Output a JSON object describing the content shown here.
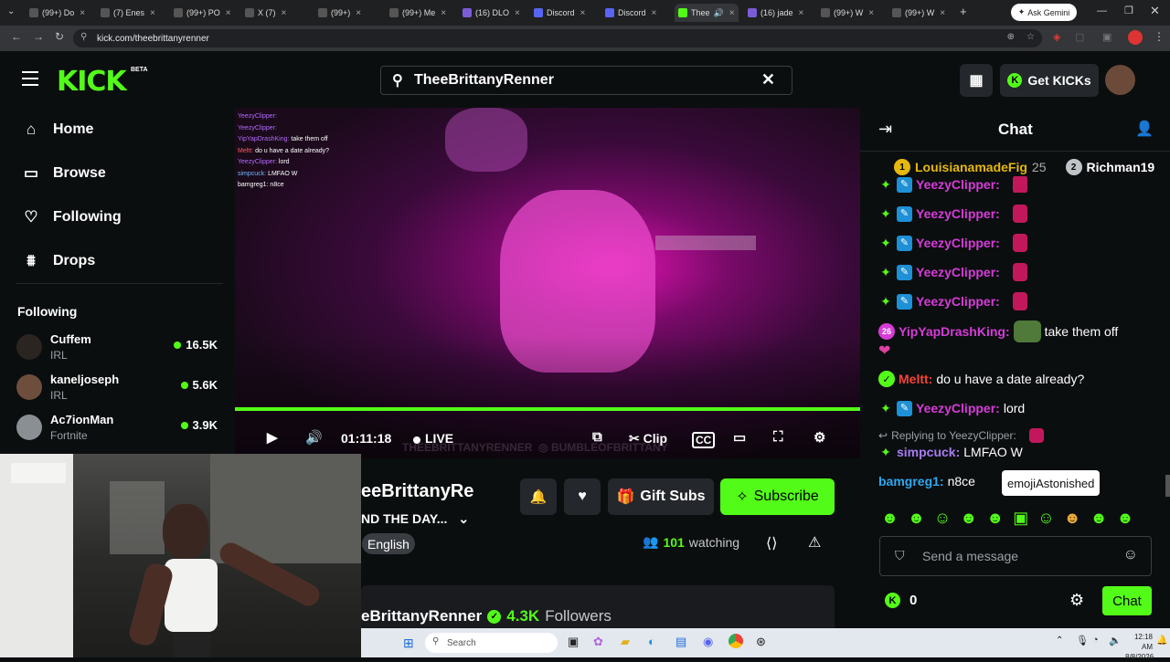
{
  "browser": {
    "tabs": [
      {
        "label": "(99+) Do"
      },
      {
        "label": "(7) Enes"
      },
      {
        "label": "(99+) PO"
      },
      {
        "label": "X (7)"
      },
      {
        "label": "(99+)"
      },
      {
        "label": "(99+) Me"
      },
      {
        "label": "(16) DLO"
      },
      {
        "label": "Discord"
      },
      {
        "label": "Discord"
      },
      {
        "label": "Thee"
      },
      {
        "label": "(16) jade"
      },
      {
        "label": "(99+) W"
      },
      {
        "label": "(99+) W"
      }
    ],
    "url": "kick.com/theebrittanyrenner",
    "ask_gemini": "Ask Gemini"
  },
  "header": {
    "logo": "KICK",
    "beta": "BETA",
    "search_value": "TheeBrittanyRenner",
    "get_kicks": "Get KICKs"
  },
  "sidebar": {
    "nav": [
      {
        "label": "Home",
        "icon": "home-icon"
      },
      {
        "label": "Browse",
        "icon": "browse-icon"
      },
      {
        "label": "Following",
        "icon": "heart-icon"
      },
      {
        "label": "Drops",
        "icon": "drops-icon"
      }
    ],
    "following_title": "Following",
    "following": [
      {
        "name": "Cuffem",
        "category": "IRL",
        "viewers": "16.5K"
      },
      {
        "name": "kaneljoseph",
        "category": "IRL",
        "viewers": "5.6K"
      },
      {
        "name": "Ac7ionMan",
        "category": "Fortnite",
        "viewers": "3.9K"
      }
    ]
  },
  "player": {
    "time": "01:11:18",
    "live": "LIVE",
    "clip": "Clip",
    "watermark": "THEEBRITTANYRENNER",
    "watermark2": "BUMBLEOFBRITTANY",
    "progress_pct": 100,
    "overlay_chat": [
      {
        "user": "YeezyClipper:",
        "text": ""
      },
      {
        "user": "YeezyClipper:",
        "text": ""
      },
      {
        "user": "YipYapDrashKing:",
        "text": "take them off"
      },
      {
        "user": "Meltt:",
        "text": "do u have a date already?"
      },
      {
        "user": "YeezyClipper:",
        "text": "lord"
      },
      {
        "user": "simpcuck:",
        "text": "LMFAO W"
      },
      {
        "user": "bamgreg1:",
        "text": "n8ce"
      }
    ]
  },
  "stream": {
    "channel": "eeBrittanyRe",
    "title": "ND THE DAY...",
    "language": "English",
    "gift_subs": "Gift Subs",
    "subscribe": "Subscribe",
    "watching_count": "101",
    "watching_label": "watching",
    "about_name": "eBrittanyRenner",
    "followers_count": "4.3K",
    "followers_label": "Followers"
  },
  "chat": {
    "title": "Chat",
    "gifters": [
      {
        "rank": "1",
        "name": "LouisianamadeFig",
        "count": "25"
      },
      {
        "rank": "2",
        "name": "Richman19",
        "count": ""
      }
    ],
    "messages": [
      {
        "user": "YeezyClipper:",
        "text": "",
        "color": "#d63cd8"
      },
      {
        "user": "YeezyClipper:",
        "text": "",
        "color": "#d63cd8"
      },
      {
        "user": "YeezyClipper:",
        "text": "",
        "color": "#d63cd8"
      },
      {
        "user": "YeezyClipper:",
        "text": "",
        "color": "#d63cd8"
      },
      {
        "user": "YeezyClipper:",
        "text": "",
        "color": "#d63cd8"
      },
      {
        "user": "YipYapDrashKing:",
        "text": "take them off",
        "color": "#d63cd8"
      },
      {
        "user": "Meltt:",
        "text": "do u have a date already?",
        "color": "#f44336"
      },
      {
        "user": "YeezyClipper:",
        "text": "lord",
        "color": "#d63cd8"
      },
      {
        "user": "simpcuck:",
        "text": "LMFAO W",
        "color": "#a77cf2"
      },
      {
        "user": "bamgreg1:",
        "text": "n8ce",
        "color": "#2ea8f0"
      }
    ],
    "replying_to": "Replying to YeezyClipper:",
    "tooltip": "emojiAstonished",
    "input_placeholder": "Send a message",
    "kicks_balance": "0",
    "chat_button": "Chat"
  },
  "taskbar": {
    "search_placeholder": "Search",
    "time": "12:18 AM",
    "date": "8/8/2026"
  },
  "colors": {
    "accent": "#53fc18",
    "background": "#0b0e0f",
    "panel": "#24272c"
  }
}
